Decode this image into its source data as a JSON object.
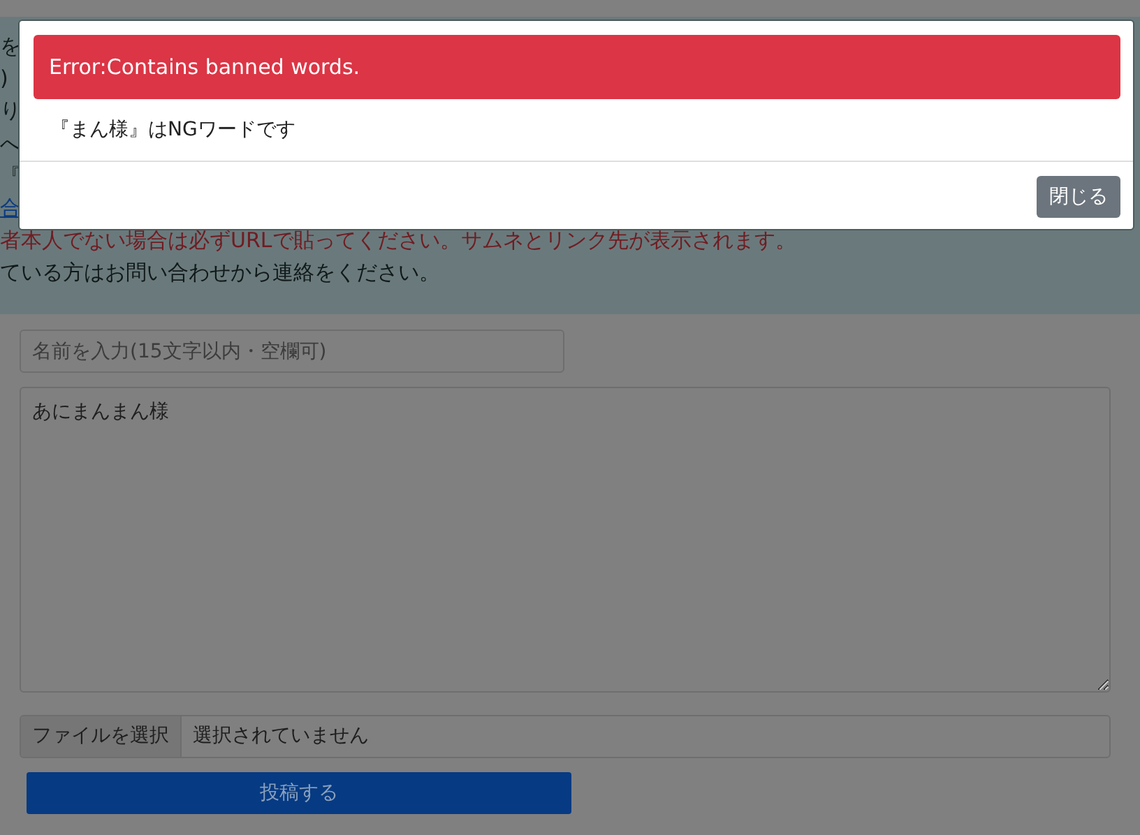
{
  "notice": {
    "lines": [
      {
        "kind": "text",
        "text": "を"
      },
      {
        "kind": "text",
        "text": ")"
      },
      {
        "kind": "text",
        "text": "り"
      },
      {
        "kind": "text",
        "text": "へ"
      },
      {
        "kind": "text",
        "text": "『"
      },
      {
        "kind": "link",
        "text": "合"
      },
      {
        "kind": "warning",
        "text": "者本人でない場合は必ずURLで貼ってください。サムネとリンク先が表示されます。"
      },
      {
        "kind": "text",
        "text": "ている方はお問い合わせから連絡をください。"
      }
    ]
  },
  "form": {
    "name_field": {
      "placeholder": "名前を入力(15文字以内・空欄可)"
    },
    "message_field": {
      "value": "あにまんまん様"
    },
    "file_input": {
      "button": "ファイルを選択",
      "status": "選択されていません"
    },
    "submit_button": "投稿する"
  },
  "modal": {
    "alert": "Error:Contains banned words.",
    "message": "『まん様』はNGワードです",
    "close_button": "閉じる"
  }
}
